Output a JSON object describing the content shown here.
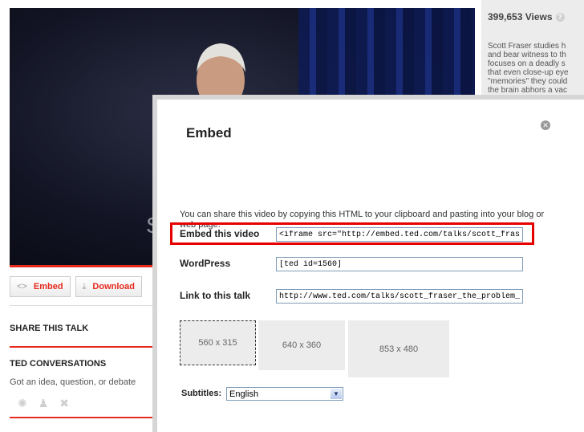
{
  "video": {
    "overlay_letter": "S"
  },
  "actions": {
    "embed": {
      "icon": "code-icon",
      "icon_glyph": "<>",
      "label": "Embed"
    },
    "download": {
      "icon": "download-icon",
      "icon_glyph": "⤓",
      "label": "Download"
    }
  },
  "sections": {
    "share_title": "SHARE THIS TALK",
    "conversations_title": "TED CONVERSATIONS",
    "conversations_text": "Got an idea, question, or debate"
  },
  "sidebar": {
    "views": "399,653 Views",
    "help_icon": "help-icon",
    "description_lines": [
      "Scott Fraser studies h",
      "and bear witness to th",
      "focuses on a deadly s",
      "that even close-up eye",
      "\"memories\" they could",
      "the brain abhors a vac"
    ]
  },
  "modal": {
    "title": "Embed",
    "close_icon": "close-icon",
    "description": "You can share this video by copying this HTML to your clipboard and pasting into your blog or web page.",
    "rows": {
      "embed": {
        "label": "Embed this video",
        "value": "<iframe src=\"http://embed.ted.com/talks/scott_fraser_th"
      },
      "wordpress": {
        "label": "WordPress",
        "value": "[ted id=1560]"
      },
      "link": {
        "label": "Link to this talk",
        "value": "http://www.ted.com/talks/scott_fraser_the_problem_wit"
      }
    },
    "sizes": [
      "560 x 315",
      "640 x 360",
      "853 x 480"
    ],
    "selected_size": "560 x 315",
    "subtitles_label": "Subtitles:",
    "subtitles_value": "English"
  },
  "colors": {
    "accent": "#e62b1e",
    "highlight": "#e60000"
  }
}
